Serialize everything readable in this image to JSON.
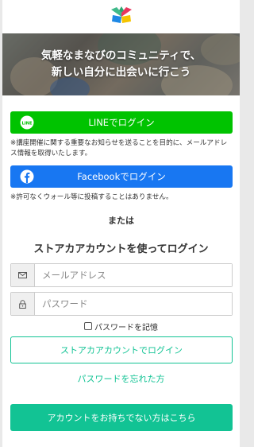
{
  "brand": {
    "logo_icon": "leaf-logo-icon",
    "colors": [
      "#3fb98a",
      "#e8365d",
      "#f5c400",
      "#1e88e5"
    ]
  },
  "hero": {
    "line1": "気軽なまなびのコミュニティで、",
    "line2": "新しい自分に出会いに行こう"
  },
  "line_login": {
    "icon": "line-icon",
    "icon_text": "LINE",
    "label": "LINEでログイン",
    "color": "#00c300",
    "note": "※講座開催に関する重要なお知らせを送ることを目的に、メールアドレス情報を取得いたします。"
  },
  "facebook_login": {
    "icon": "facebook-icon",
    "label": "Facebookでログイン",
    "color": "#1877f2",
    "note": "※許可なくウォール等に投稿することはありません。"
  },
  "divider_text": "または",
  "store_login": {
    "title": "ストアカアカウントを使ってログイン",
    "email": {
      "icon": "envelope-icon",
      "placeholder": "メールアドレス",
      "value": ""
    },
    "password": {
      "icon": "lock-icon",
      "placeholder": "パスワード",
      "value": ""
    },
    "remember_label": "パスワードを記憶",
    "remember_checked": false,
    "submit_label": "ストアカアカウントでログイン",
    "forgot_label": "パスワードを忘れた方",
    "signup_label": "アカウントをお持ちでない方はこちら",
    "accent": "#12c394"
  }
}
